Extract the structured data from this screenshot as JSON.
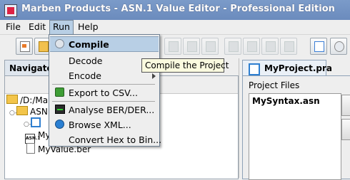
{
  "window": {
    "title": "Marben Products - ASN.1 Value Editor - Professional Edition"
  },
  "menubar": {
    "items": [
      "File",
      "Edit",
      "Run",
      "Help"
    ]
  },
  "run_menu": {
    "items": [
      {
        "label": "Compile",
        "icon": "gear-icon"
      },
      {
        "label": "Decode",
        "has_submenu": true
      },
      {
        "label": "Encode",
        "has_submenu": true
      },
      {
        "label": "Export to CSV...",
        "icon": "export-icon"
      },
      {
        "label": "Analyse BER/DER...",
        "icon": "analyser-icon"
      },
      {
        "label": "Browse XML...",
        "icon": "globe-icon"
      },
      {
        "label": "Convert Hex to Bin..."
      }
    ]
  },
  "tooltip": {
    "text": "Compile the Project"
  },
  "navigator": {
    "tab_label": "Navigator",
    "tree": [
      "/D:/Marben",
      "ASN",
      "",
      "MySyntax.asn",
      "MyValue.ber"
    ]
  },
  "project": {
    "tab_label": "MyProject.pra",
    "files_label": "Project Files",
    "files": [
      "MySyntax.asn"
    ]
  },
  "colors": {
    "title_bar": "#6b8bbd",
    "menu_highlight": "#b8cfe5",
    "tooltip_bg": "#fafadf"
  }
}
